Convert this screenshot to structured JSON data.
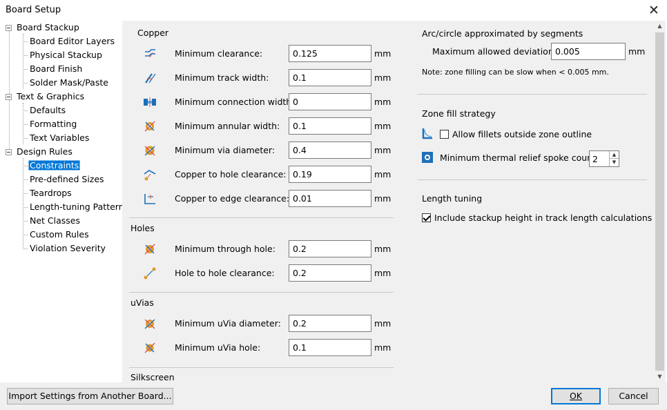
{
  "window": {
    "title": "Board Setup",
    "close_symbol": "✕"
  },
  "tree": [
    {
      "label": "Board Stackup",
      "level": 0
    },
    {
      "label": "Board Editor Layers",
      "level": 1
    },
    {
      "label": "Physical Stackup",
      "level": 1
    },
    {
      "label": "Board Finish",
      "level": 1
    },
    {
      "label": "Solder Mask/Paste",
      "level": 1
    },
    {
      "label": "Text & Graphics",
      "level": 0
    },
    {
      "label": "Defaults",
      "level": 1
    },
    {
      "label": "Formatting",
      "level": 1
    },
    {
      "label": "Text Variables",
      "level": 1
    },
    {
      "label": "Design Rules",
      "level": 0
    },
    {
      "label": "Constraints",
      "level": 1,
      "selected": true
    },
    {
      "label": "Pre-defined Sizes",
      "level": 1
    },
    {
      "label": "Teardrops",
      "level": 1
    },
    {
      "label": "Length-tuning Patterns",
      "level": 1
    },
    {
      "label": "Net Classes",
      "level": 1
    },
    {
      "label": "Custom Rules",
      "level": 1
    },
    {
      "label": "Violation Severity",
      "level": 1
    }
  ],
  "copper": {
    "title": "Copper",
    "rows": [
      {
        "label": "Minimum clearance:",
        "value": "0.125",
        "unit": "mm",
        "icon": "clearance-icon"
      },
      {
        "label": "Minimum track width:",
        "value": "0.1",
        "unit": "mm",
        "icon": "track-width-icon"
      },
      {
        "label": "Minimum connection width:",
        "value": "0",
        "unit": "mm",
        "icon": "connection-width-icon"
      },
      {
        "label": "Minimum annular width:",
        "value": "0.1",
        "unit": "mm",
        "icon": "annular-width-icon"
      },
      {
        "label": "Minimum via diameter:",
        "value": "0.4",
        "unit": "mm",
        "icon": "via-diameter-icon"
      },
      {
        "label": "Copper to hole clearance:",
        "value": "0.19",
        "unit": "mm",
        "icon": "hole-clearance-icon"
      },
      {
        "label": "Copper to edge clearance:",
        "value": "0.01",
        "unit": "mm",
        "icon": "edge-clearance-icon"
      }
    ]
  },
  "holes": {
    "title": "Holes",
    "rows": [
      {
        "label": "Minimum through hole:",
        "value": "0.2",
        "unit": "mm",
        "icon": "through-hole-icon"
      },
      {
        "label": "Hole to hole clearance:",
        "value": "0.2",
        "unit": "mm",
        "icon": "hole-to-hole-icon"
      }
    ]
  },
  "uvias": {
    "title": "uVias",
    "rows": [
      {
        "label": "Minimum uVia diameter:",
        "value": "0.2",
        "unit": "mm",
        "icon": "uvia-diameter-icon"
      },
      {
        "label": "Minimum uVia hole:",
        "value": "0.1",
        "unit": "mm",
        "icon": "uvia-hole-icon"
      }
    ]
  },
  "silkscreen": {
    "title": "Silkscreen"
  },
  "arc": {
    "title": "Arc/circle approximated by segments",
    "deviation_label": "Maximum allowed deviation:",
    "deviation_value": "0.005",
    "unit": "mm",
    "note": "Note: zone filling can be slow when < 0.005 mm."
  },
  "zone": {
    "title": "Zone fill strategy",
    "fillets_label": "Allow fillets outside zone outline",
    "fillets_checked": false,
    "spoke_label": "Minimum thermal relief spoke count:",
    "spoke_value": "2"
  },
  "length": {
    "title": "Length tuning",
    "stackup_label": "Include stackup height in track length calculations",
    "stackup_checked": true
  },
  "footer": {
    "import_label": "Import Settings from Another Board...",
    "ok_label": "OK",
    "cancel_label": "Cancel"
  }
}
